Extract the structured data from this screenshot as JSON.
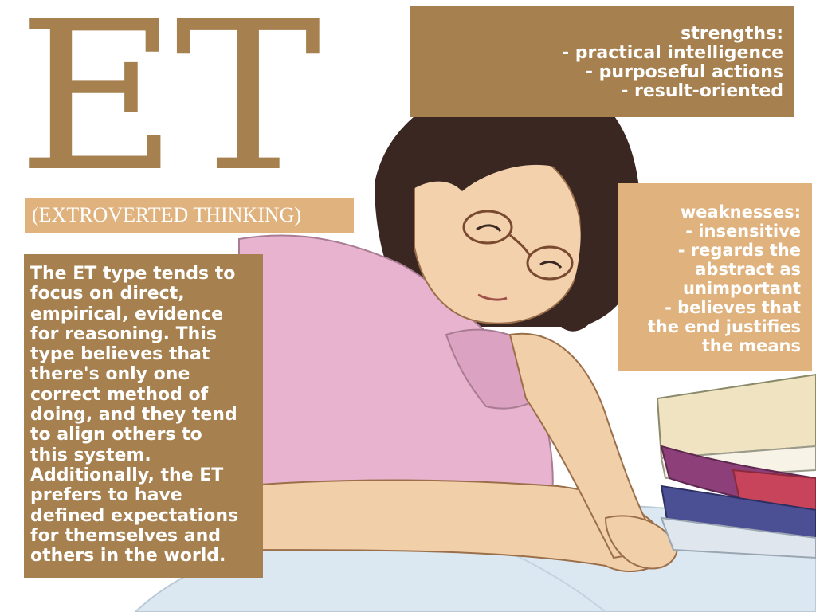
{
  "title": "ET",
  "subtitle": "(EXTROVERTED THINKING)",
  "strengths": {
    "lines": [
      "strengths:",
      "- practical intelligence",
      "- purposeful actions",
      "- result-oriented"
    ]
  },
  "weaknesses": {
    "lines": [
      "weaknesses:",
      "- insensitive",
      "- regards the",
      "abstract as",
      "unimportant",
      "- believes that",
      "the end justifies",
      "the means"
    ]
  },
  "description": {
    "lines": [
      "The ET type tends to",
      "focus on direct,",
      "empirical, evidence",
      "for reasoning. This",
      "type believes that",
      "there's only one",
      "correct method of",
      "doing, and they tend",
      "to align others to",
      "this system.",
      "Additionally, the ET",
      "prefers to have",
      "defined expectations",
      "for themselves and",
      "others in the world."
    ]
  },
  "colors": {
    "brown": "#a6804f",
    "tan": "#dfb27e",
    "text": "#ffffff"
  }
}
